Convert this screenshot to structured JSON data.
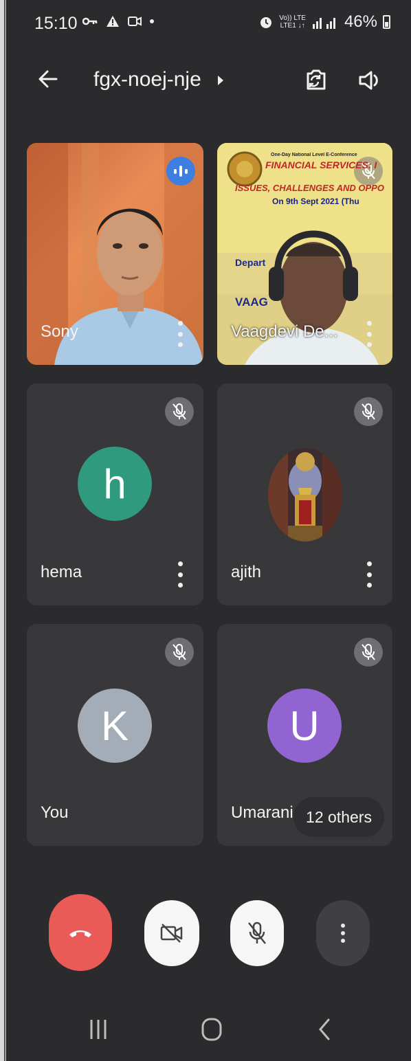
{
  "status_bar": {
    "time": "15:10",
    "network_top": "Vo)) LTE",
    "network_bottom": "LTE1 ↓↑",
    "battery": "46%"
  },
  "header": {
    "meeting_code": "fgx-noej-nje"
  },
  "participants": [
    {
      "name": "Sony",
      "video": true,
      "speaking": true
    },
    {
      "name": "Vaagdevi De...",
      "video": true,
      "muted": true
    },
    {
      "name": "hema",
      "initial": "h",
      "avatar_color": "#2f9a7e",
      "muted": true
    },
    {
      "name": "ajith",
      "image_avatar": true,
      "muted": true
    },
    {
      "name": "You",
      "initial": "K",
      "avatar_color": "#a3acb7",
      "muted": true
    },
    {
      "name": "Umarani",
      "initial": "U",
      "avatar_color": "#9164d2",
      "muted": true
    }
  ],
  "others_label": "12 others",
  "banner": {
    "line1": "One-Day National Level E-Conference",
    "line2": "FINANCIAL SERVICES: I",
    "line3": "ISSUES, CHALLENGES AND OPPO",
    "line4": "On 9th Sept 2021 (Thu",
    "line5": "Depart",
    "line6": "VAAG"
  },
  "colors": {
    "hangup": "#ea5a56",
    "speaking": "#3d7fe0"
  }
}
